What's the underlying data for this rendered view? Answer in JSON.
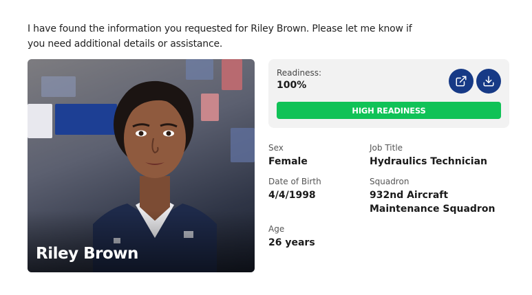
{
  "message": {
    "text": "I have found the information you requested for Riley Brown. Please let me know if you need additional details or assistance."
  },
  "profile": {
    "name": "Riley Brown",
    "photo_description": "portrait-photo"
  },
  "readiness": {
    "label": "Readiness:",
    "value": "100%",
    "level_percent": 100,
    "status_text": "HIGH READINESS",
    "status_color": "#10c257",
    "button_color": "#173a86",
    "open_icon": "external-link-icon",
    "download_icon": "download-icon"
  },
  "details": {
    "sex": {
      "label": "Sex",
      "value": "Female"
    },
    "job_title": {
      "label": "Job Title",
      "value": "Hydraulics Technician"
    },
    "date_of_birth": {
      "label": "Date of Birth",
      "value": "4/4/1998"
    },
    "squadron": {
      "label": "Squadron",
      "value": "932nd Aircraft Maintenance Squadron"
    },
    "age": {
      "label": "Age",
      "value": "26 years"
    }
  }
}
